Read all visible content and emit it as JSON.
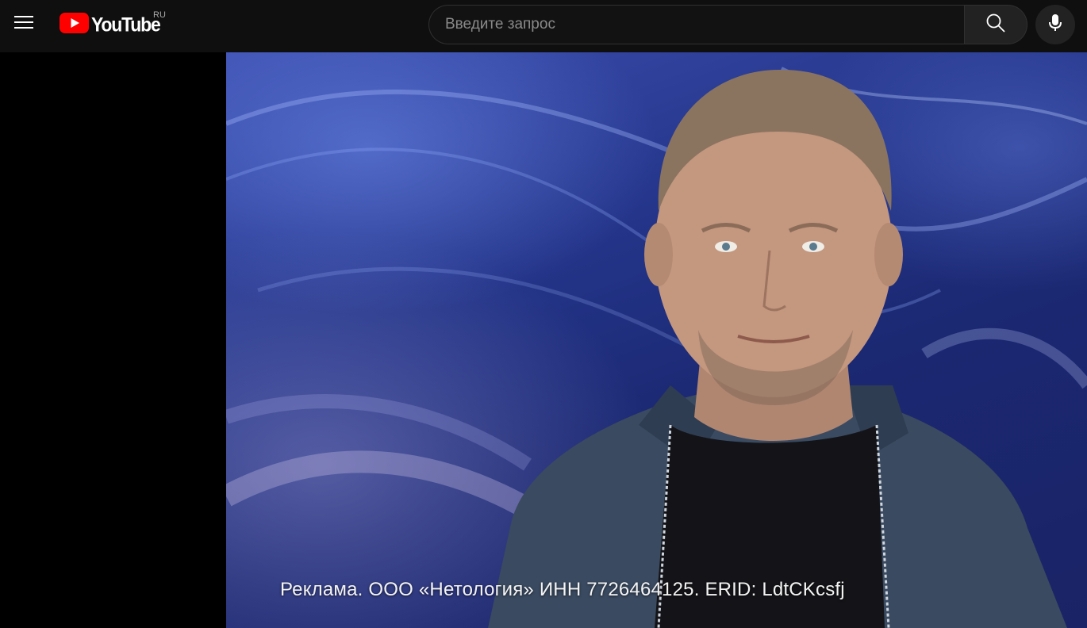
{
  "masthead": {
    "logo_text": "YouTube",
    "country_code": "RU",
    "search_placeholder": "Введите запрос",
    "search_value": "",
    "icons": {
      "menu": "hamburger-menu-icon",
      "logo": "youtube-play-icon",
      "search": "search-icon",
      "mic": "microphone-icon"
    },
    "colors": {
      "brand_red": "#ff0000",
      "background": "#0f0f0f"
    }
  },
  "player": {
    "ad_caption": "Реклама. ООО «Нетология» ИНН 7726464125. ERID: LdtCKcsfj"
  }
}
